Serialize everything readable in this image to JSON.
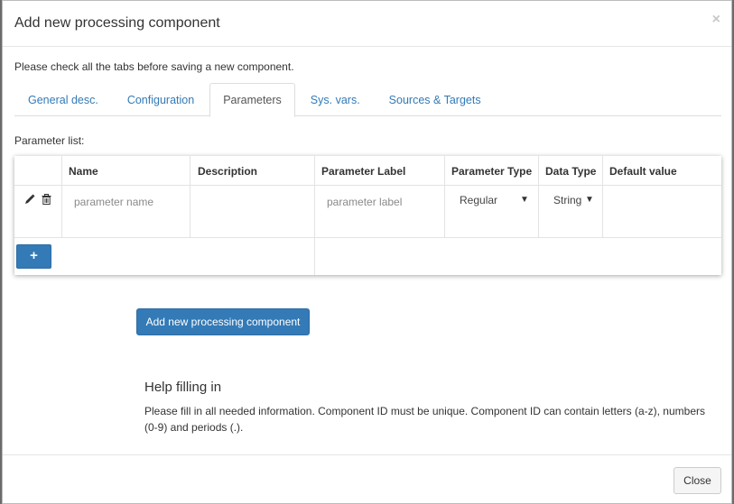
{
  "modal": {
    "title": "Add new processing component",
    "close_glyph": "×"
  },
  "intro": "Please check all the tabs before saving a new component.",
  "tabs": [
    {
      "label": "General desc."
    },
    {
      "label": "Configuration"
    },
    {
      "label": "Parameters",
      "active": true
    },
    {
      "label": "Sys. vars."
    },
    {
      "label": "Sources & Targets"
    }
  ],
  "param_list_label": "Parameter list:",
  "table": {
    "headers": [
      "Name",
      "Description",
      "Parameter Label",
      "Parameter Type",
      "Data Type",
      "Default value"
    ],
    "row": {
      "name_placeholder": "parameter name",
      "label_placeholder": "parameter label",
      "param_type": "Regular",
      "data_type": "String",
      "edit_icon": "pencil-icon",
      "delete_icon": "trash-icon"
    },
    "add_button_label": "+"
  },
  "primary_button": "Add new processing component",
  "help": {
    "title": "Help filling in",
    "text": "Please fill in all needed information. Component ID must be unique. Component ID can contain letters (a-z), numbers (0-9) and periods (.)."
  },
  "close_button": "Close",
  "colors": {
    "primary": "#337ab7",
    "tab_link": "#337ab7"
  }
}
